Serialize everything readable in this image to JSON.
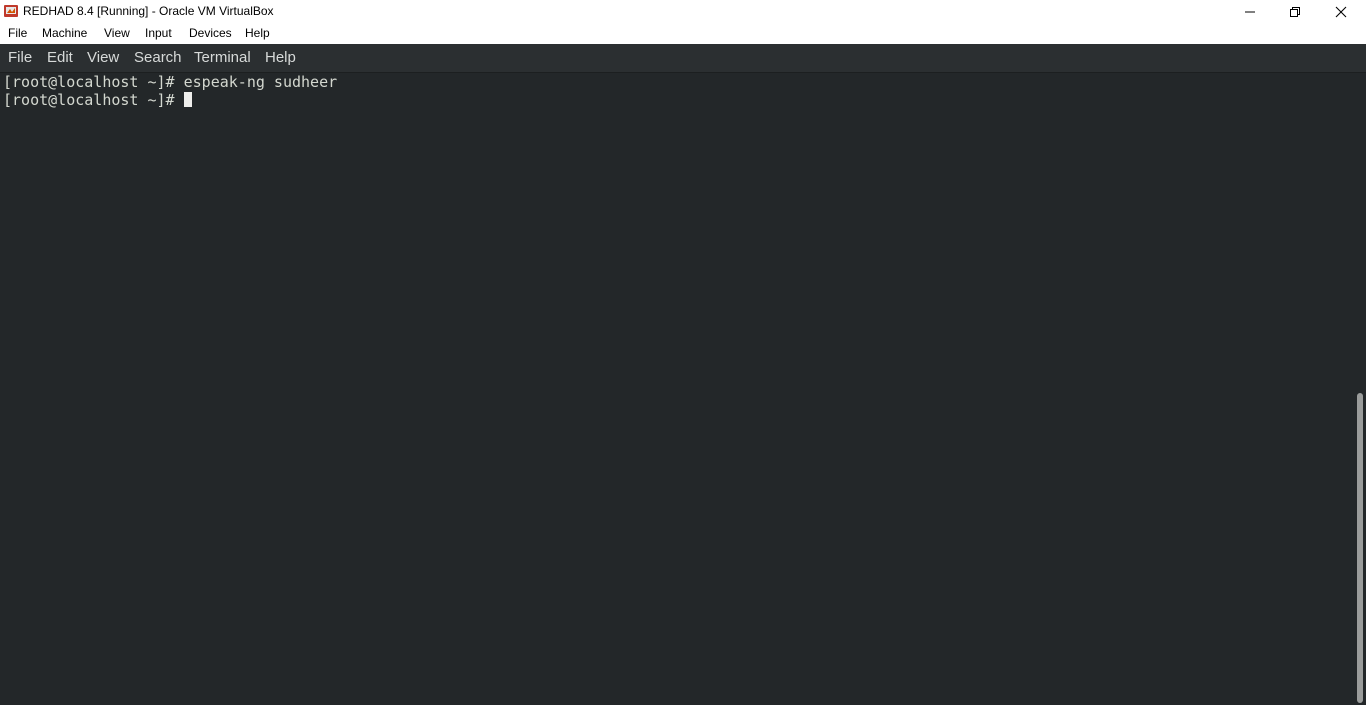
{
  "window": {
    "title": "REDHAD 8.4 [Running] - Oracle VM VirtualBox",
    "app_icon": "virtualbox-icon",
    "controls": [
      "minimize-icon",
      "restore-icon",
      "close-icon"
    ]
  },
  "vbox_menu": {
    "items": [
      "File",
      "Machine",
      "View",
      "Input",
      "Devices",
      "Help"
    ]
  },
  "terminal": {
    "menu": {
      "items": [
        "File",
        "Edit",
        "View",
        "Search",
        "Terminal",
        "Help"
      ]
    },
    "lines": [
      {
        "prompt": "[root@localhost ~]#",
        "command": " espeak-ng sudheer"
      },
      {
        "prompt": "[root@localhost ~]#",
        "command": " "
      }
    ],
    "colors": {
      "background": "#232729",
      "foreground": "#d3d7cf"
    }
  }
}
